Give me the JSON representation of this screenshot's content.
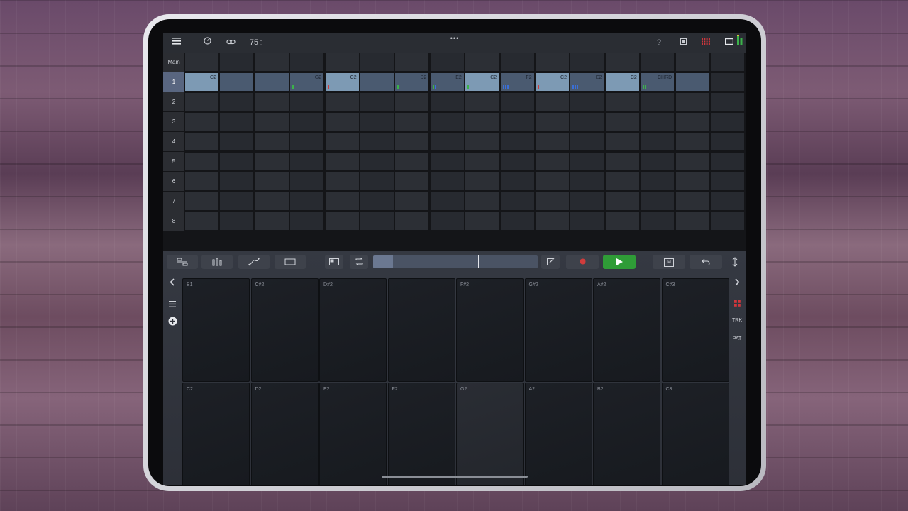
{
  "topbar": {
    "menu_icon": "hamburger-icon",
    "metronome_icon": "metronome-icon",
    "tape_icon": "tape-icon",
    "tempo": "75",
    "tempo_dots": "⋮",
    "drag_handle": "•••",
    "help": "?",
    "stop_icon": "stop-icon",
    "grid_icon": "grid-icon",
    "window_icon": "window-icon",
    "meter_icon": "level-meter-icon"
  },
  "grid": {
    "header_label": "Main",
    "rows": [
      "1",
      "2",
      "3",
      "4",
      "5",
      "6",
      "7",
      "8"
    ],
    "selected_row": "1",
    "row1_cells": [
      {
        "label": "C2",
        "state": "hl",
        "marks": []
      },
      {
        "label": "",
        "state": "lit",
        "marks": []
      },
      {
        "label": "",
        "state": "lit",
        "marks": []
      },
      {
        "label": "G2",
        "state": "lit",
        "marks": [
          "#3bb34a"
        ]
      },
      {
        "label": "C2",
        "state": "hl",
        "marks": [
          "#d03c3c"
        ]
      },
      {
        "label": "",
        "state": "lit",
        "marks": []
      },
      {
        "label": "D2",
        "state": "lit",
        "marks": [
          "#3bb34a"
        ]
      },
      {
        "label": "E2",
        "state": "lit",
        "marks": [
          "#3bb34a",
          "#3a6fd8"
        ]
      },
      {
        "label": "C2",
        "state": "hl",
        "marks": [
          "#3bb34a"
        ]
      },
      {
        "label": "F2",
        "state": "lit",
        "marks": [
          "#3a6fd8",
          "#3a6fd8",
          "#3a6fd8"
        ]
      },
      {
        "label": "C2",
        "state": "hl",
        "marks": [
          "#d03c3c"
        ]
      },
      {
        "label": "E2",
        "state": "lit",
        "marks": [
          "#3a6fd8",
          "#3a6fd8",
          "#3a6fd8"
        ]
      },
      {
        "label": "C2",
        "state": "hl",
        "marks": []
      },
      {
        "label": "CHRD",
        "state": "lit",
        "marks": [
          "#3bb34a",
          "#3bb34a"
        ]
      },
      {
        "label": "",
        "state": "lit",
        "marks": []
      },
      {
        "label": "",
        "state": "none",
        "marks": []
      }
    ]
  },
  "toolbar": {
    "seq_icon": "sequencer-icon",
    "bars_icon": "bars-icon",
    "curve_icon": "automation-icon",
    "box_icon": "clip-icon",
    "split_icon": "split-view-icon",
    "loop_icon": "loop-icon",
    "edit_icon": "edit-icon",
    "record_icon": "record-icon",
    "play_icon": "play-icon",
    "m_label": "M",
    "undo_icon": "undo-icon",
    "expand_icon": "expand-icon"
  },
  "side_left": {
    "prev_icon": "chevron-left-icon",
    "list_icon": "list-icon",
    "add_icon": "add-icon"
  },
  "side_right": {
    "next_icon": "chevron-right-icon",
    "grid_icon": "grid-icon",
    "trk_label": "TRK",
    "pat_label": "PAT"
  },
  "pads": {
    "top": [
      "B1",
      "C#2",
      "D#2",
      "",
      "F#2",
      "G#2",
      "A#2",
      "C#3"
    ],
    "bottom": [
      "C2",
      "D2",
      "E2",
      "F2",
      "G2",
      "A2",
      "B2",
      "C3"
    ]
  },
  "colors": {
    "accent_green": "#2f9c37",
    "record_red": "#d03c3c",
    "selected_cell": "#7d9ab4"
  }
}
